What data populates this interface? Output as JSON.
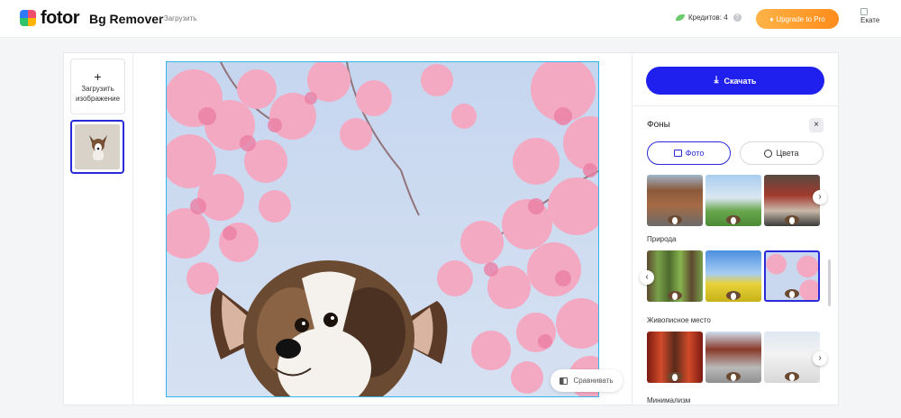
{
  "header": {
    "logo_text": "fotor",
    "product": "Bg Remover",
    "breadcrumb": "Загрузить",
    "credits_label": "Кредитов: 4",
    "help_icon": "?",
    "upgrade_label": "Upgrade to Pro",
    "user_label": "Екате"
  },
  "sidebar": {
    "upload_plus": "+",
    "upload_label": "Загрузить изображение"
  },
  "canvas": {
    "compare_label": "Сравнивать"
  },
  "panel": {
    "download_label": "Скачать",
    "backgrounds_title": "Фоны",
    "close_glyph": "×",
    "tabs": [
      {
        "label": "Фото",
        "active": true
      },
      {
        "label": "Цвета",
        "active": false
      }
    ],
    "categories": [
      {
        "label": "Природа"
      },
      {
        "label": "Живописное место"
      },
      {
        "label": "Минимализм"
      }
    ],
    "arrow_right": "›",
    "arrow_left": "‹"
  },
  "colors": {
    "accent": "#2a2ad8",
    "download": "#2020ee",
    "pro_gradient_start": "#ffb347",
    "pro_gradient_end": "#ff8c1a",
    "canvas_border": "#36b3ea"
  }
}
